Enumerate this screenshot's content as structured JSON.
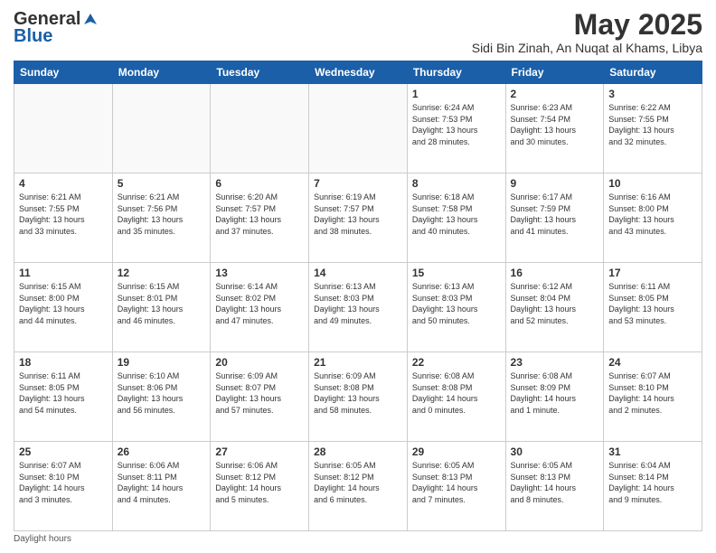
{
  "logo": {
    "general": "General",
    "blue": "Blue"
  },
  "title": "May 2025",
  "subtitle": "Sidi Bin Zinah, An Nuqat al Khams, Libya",
  "footer": "Daylight hours",
  "headers": [
    "Sunday",
    "Monday",
    "Tuesday",
    "Wednesday",
    "Thursday",
    "Friday",
    "Saturday"
  ],
  "weeks": [
    [
      {
        "day": "",
        "info": ""
      },
      {
        "day": "",
        "info": ""
      },
      {
        "day": "",
        "info": ""
      },
      {
        "day": "",
        "info": ""
      },
      {
        "day": "1",
        "info": "Sunrise: 6:24 AM\nSunset: 7:53 PM\nDaylight: 13 hours\nand 28 minutes."
      },
      {
        "day": "2",
        "info": "Sunrise: 6:23 AM\nSunset: 7:54 PM\nDaylight: 13 hours\nand 30 minutes."
      },
      {
        "day": "3",
        "info": "Sunrise: 6:22 AM\nSunset: 7:55 PM\nDaylight: 13 hours\nand 32 minutes."
      }
    ],
    [
      {
        "day": "4",
        "info": "Sunrise: 6:21 AM\nSunset: 7:55 PM\nDaylight: 13 hours\nand 33 minutes."
      },
      {
        "day": "5",
        "info": "Sunrise: 6:21 AM\nSunset: 7:56 PM\nDaylight: 13 hours\nand 35 minutes."
      },
      {
        "day": "6",
        "info": "Sunrise: 6:20 AM\nSunset: 7:57 PM\nDaylight: 13 hours\nand 37 minutes."
      },
      {
        "day": "7",
        "info": "Sunrise: 6:19 AM\nSunset: 7:57 PM\nDaylight: 13 hours\nand 38 minutes."
      },
      {
        "day": "8",
        "info": "Sunrise: 6:18 AM\nSunset: 7:58 PM\nDaylight: 13 hours\nand 40 minutes."
      },
      {
        "day": "9",
        "info": "Sunrise: 6:17 AM\nSunset: 7:59 PM\nDaylight: 13 hours\nand 41 minutes."
      },
      {
        "day": "10",
        "info": "Sunrise: 6:16 AM\nSunset: 8:00 PM\nDaylight: 13 hours\nand 43 minutes."
      }
    ],
    [
      {
        "day": "11",
        "info": "Sunrise: 6:15 AM\nSunset: 8:00 PM\nDaylight: 13 hours\nand 44 minutes."
      },
      {
        "day": "12",
        "info": "Sunrise: 6:15 AM\nSunset: 8:01 PM\nDaylight: 13 hours\nand 46 minutes."
      },
      {
        "day": "13",
        "info": "Sunrise: 6:14 AM\nSunset: 8:02 PM\nDaylight: 13 hours\nand 47 minutes."
      },
      {
        "day": "14",
        "info": "Sunrise: 6:13 AM\nSunset: 8:03 PM\nDaylight: 13 hours\nand 49 minutes."
      },
      {
        "day": "15",
        "info": "Sunrise: 6:13 AM\nSunset: 8:03 PM\nDaylight: 13 hours\nand 50 minutes."
      },
      {
        "day": "16",
        "info": "Sunrise: 6:12 AM\nSunset: 8:04 PM\nDaylight: 13 hours\nand 52 minutes."
      },
      {
        "day": "17",
        "info": "Sunrise: 6:11 AM\nSunset: 8:05 PM\nDaylight: 13 hours\nand 53 minutes."
      }
    ],
    [
      {
        "day": "18",
        "info": "Sunrise: 6:11 AM\nSunset: 8:05 PM\nDaylight: 13 hours\nand 54 minutes."
      },
      {
        "day": "19",
        "info": "Sunrise: 6:10 AM\nSunset: 8:06 PM\nDaylight: 13 hours\nand 56 minutes."
      },
      {
        "day": "20",
        "info": "Sunrise: 6:09 AM\nSunset: 8:07 PM\nDaylight: 13 hours\nand 57 minutes."
      },
      {
        "day": "21",
        "info": "Sunrise: 6:09 AM\nSunset: 8:08 PM\nDaylight: 13 hours\nand 58 minutes."
      },
      {
        "day": "22",
        "info": "Sunrise: 6:08 AM\nSunset: 8:08 PM\nDaylight: 14 hours\nand 0 minutes."
      },
      {
        "day": "23",
        "info": "Sunrise: 6:08 AM\nSunset: 8:09 PM\nDaylight: 14 hours\nand 1 minute."
      },
      {
        "day": "24",
        "info": "Sunrise: 6:07 AM\nSunset: 8:10 PM\nDaylight: 14 hours\nand 2 minutes."
      }
    ],
    [
      {
        "day": "25",
        "info": "Sunrise: 6:07 AM\nSunset: 8:10 PM\nDaylight: 14 hours\nand 3 minutes."
      },
      {
        "day": "26",
        "info": "Sunrise: 6:06 AM\nSunset: 8:11 PM\nDaylight: 14 hours\nand 4 minutes."
      },
      {
        "day": "27",
        "info": "Sunrise: 6:06 AM\nSunset: 8:12 PM\nDaylight: 14 hours\nand 5 minutes."
      },
      {
        "day": "28",
        "info": "Sunrise: 6:05 AM\nSunset: 8:12 PM\nDaylight: 14 hours\nand 6 minutes."
      },
      {
        "day": "29",
        "info": "Sunrise: 6:05 AM\nSunset: 8:13 PM\nDaylight: 14 hours\nand 7 minutes."
      },
      {
        "day": "30",
        "info": "Sunrise: 6:05 AM\nSunset: 8:13 PM\nDaylight: 14 hours\nand 8 minutes."
      },
      {
        "day": "31",
        "info": "Sunrise: 6:04 AM\nSunset: 8:14 PM\nDaylight: 14 hours\nand 9 minutes."
      }
    ]
  ]
}
